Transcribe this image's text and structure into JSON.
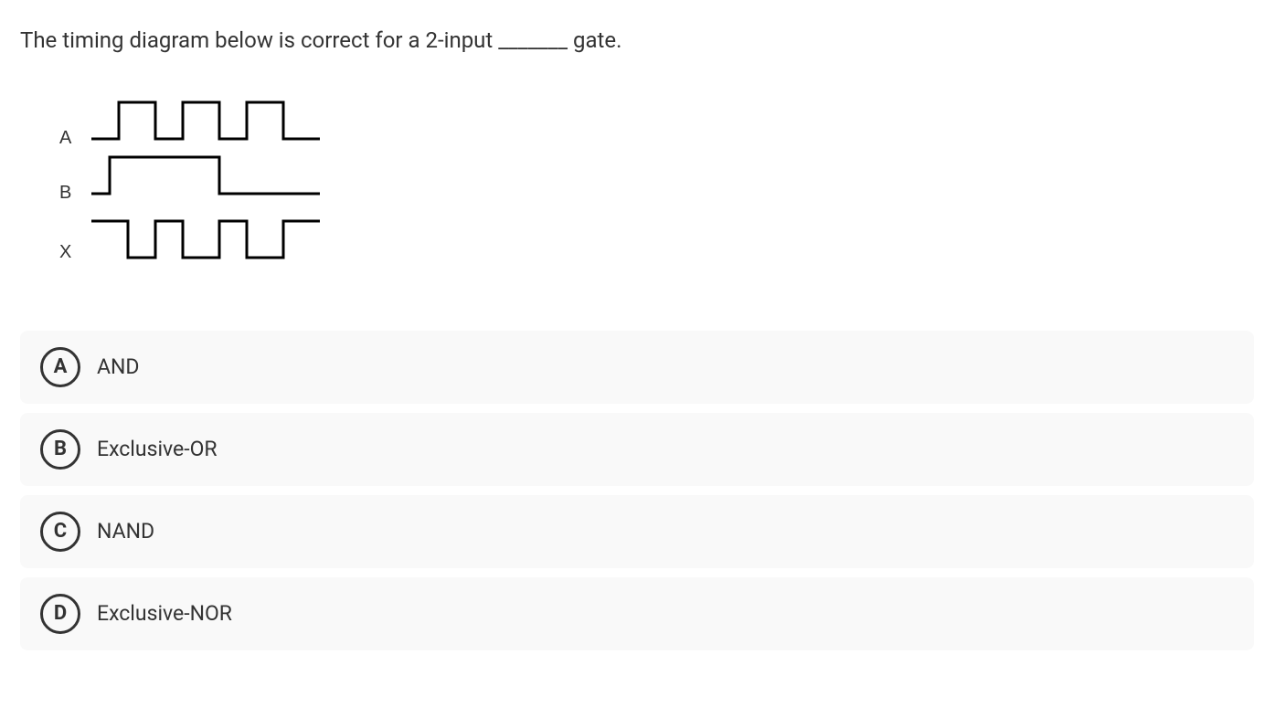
{
  "question": {
    "text": "The timing diagram below is correct for a 2-input _______ gate."
  },
  "timing_diagram": {
    "signals": [
      {
        "label": "A",
        "pattern": [
          0,
          0,
          1,
          0,
          1,
          0,
          1,
          0
        ]
      },
      {
        "label": "B",
        "pattern": [
          0,
          1,
          1,
          1,
          0,
          0,
          0,
          0
        ]
      },
      {
        "label": "X",
        "pattern": [
          1,
          0,
          1,
          0,
          0,
          1,
          0,
          1
        ]
      }
    ]
  },
  "options": [
    {
      "letter": "A",
      "text": "AND"
    },
    {
      "letter": "B",
      "text": "Exclusive-OR"
    },
    {
      "letter": "C",
      "text": "NAND"
    },
    {
      "letter": "D",
      "text": "Exclusive-NOR"
    }
  ]
}
